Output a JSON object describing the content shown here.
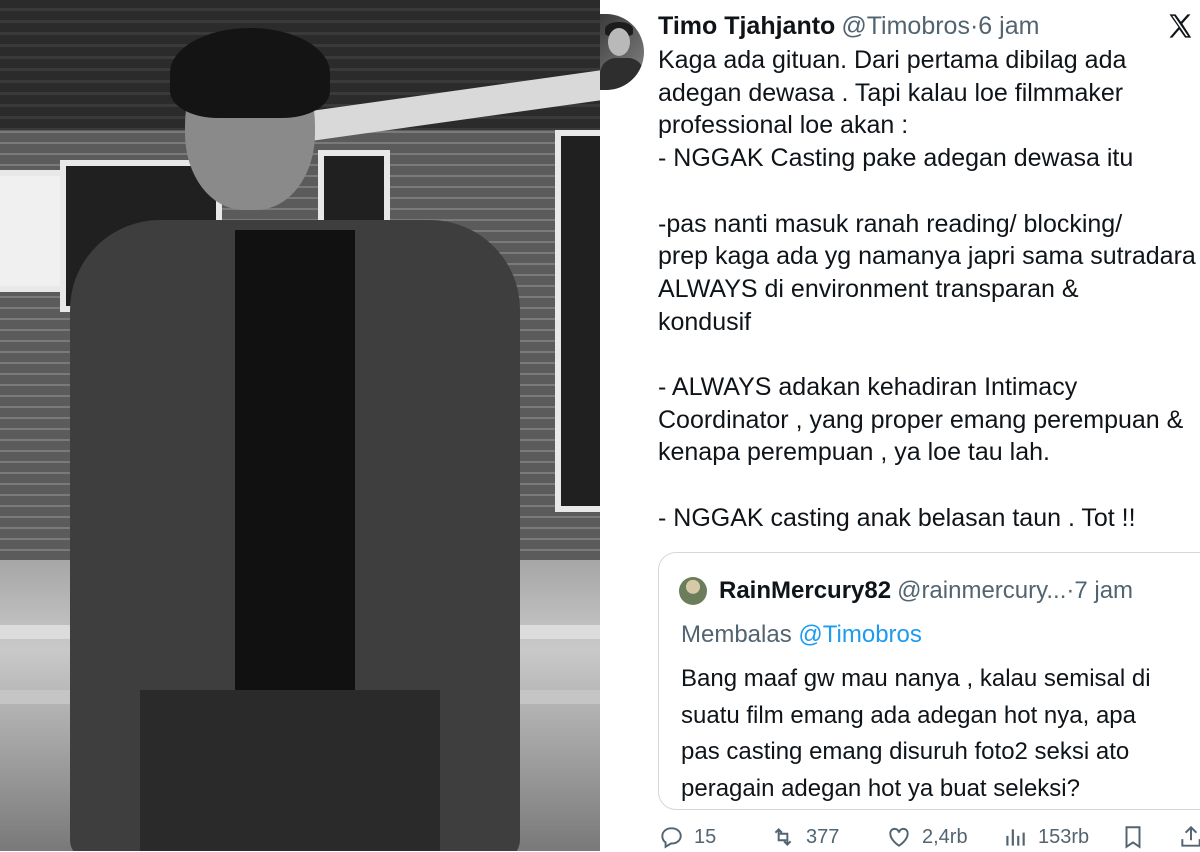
{
  "tweet": {
    "name": "Timo Tjahjanto",
    "handle": "@Timobros",
    "separator": "·",
    "time": "6 jam",
    "body": "Kaga ada gituan.  Dari pertama dibilag ada\nadegan dewasa .  Tapi kalau loe filmmaker\nprofessional loe akan :\n- NGGAK Casting pake adegan dewasa itu\n\n-pas nanti masuk ranah reading/ blocking/\nprep kaga ada yg namanya japri sama sutradara\nALWAYS  di environment transparan &\nkondusif\n\n-  ALWAYS adakan kehadiran Intimacy\nCoordinator , yang proper emang perempuan &\nkenapa perempuan , ya loe tau lah.\n\n- NGGAK casting anak belasan taun .  Tot !!"
  },
  "quote": {
    "name": "RainMercury82",
    "handle": "@rainmercury...",
    "separator": "·",
    "time": "7 jam",
    "reply_prefix": "Membalas",
    "reply_mention": "@Timobros",
    "body": "Bang maaf gw mau nanya , kalau semisal di\nsuatu film emang ada adegan hot nya, apa\npas casting emang disuruh foto2 seksi ato\nperagain adegan hot ya buat seleksi?"
  },
  "actions": {
    "replies": "15",
    "reposts": "377",
    "likes": "2,4rb",
    "views": "153rb"
  },
  "icons": {
    "brand": "x-logo-icon",
    "reply": "reply-icon",
    "repost": "repost-icon",
    "like": "heart-icon",
    "views": "views-icon",
    "bookmark": "bookmark-icon",
    "share": "share-icon"
  },
  "colors": {
    "text": "#0f1419",
    "muted": "#536471",
    "link": "#1d9bf0",
    "border": "#cfd9de"
  }
}
